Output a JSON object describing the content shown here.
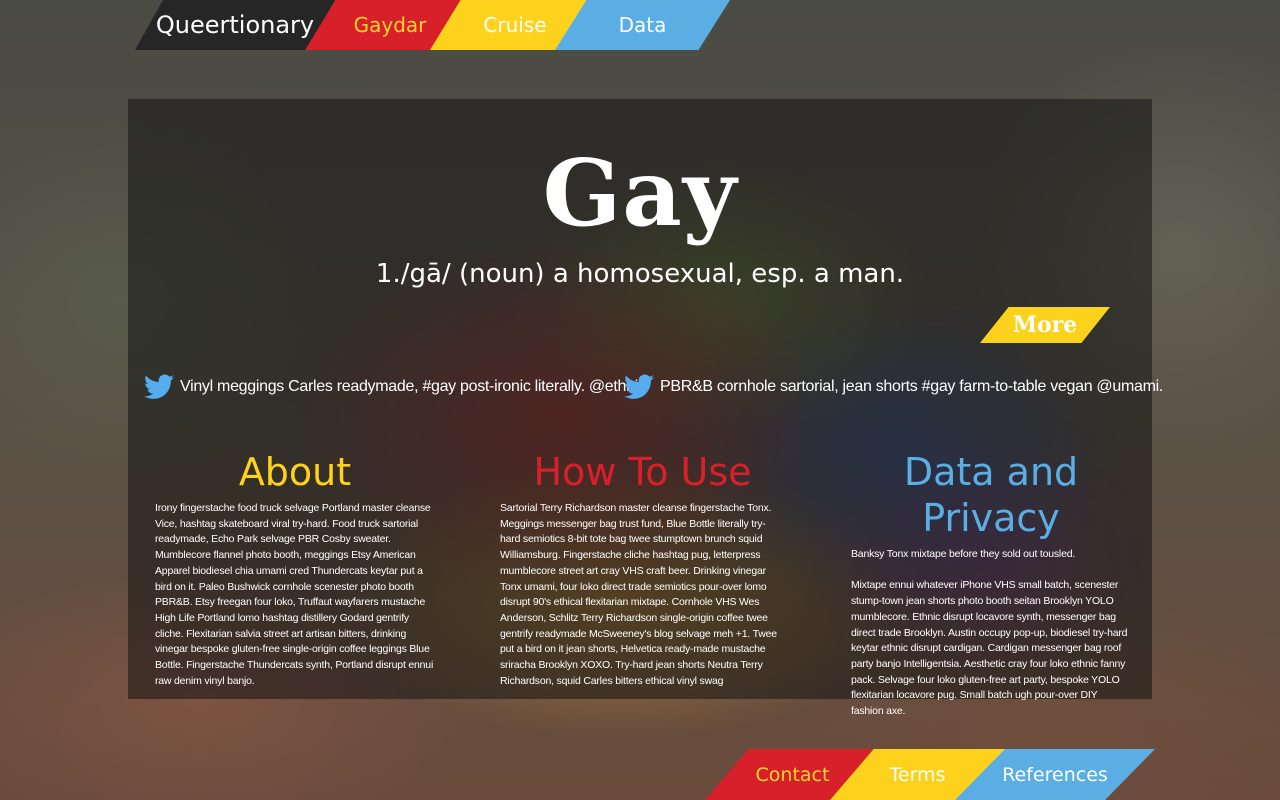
{
  "nav": {
    "brand": "Queertionary",
    "items": [
      {
        "label": "Gaydar",
        "color": "#d7202a"
      },
      {
        "label": "Cruise",
        "color": "#fcd21c"
      },
      {
        "label": "Data",
        "color": "#5aaee3"
      }
    ]
  },
  "entry": {
    "word": "Gay",
    "definition": "1./gā/ (noun) a homosexual, esp. a man.",
    "more_label": "More"
  },
  "tweets": [
    {
      "icon": "twitter-bird-icon",
      "text": "Vinyl meggings Carles readymade, #gay post-ironic literally. @ethnic"
    },
    {
      "icon": "twitter-bird-icon",
      "text": "PBR&B cornhole sartorial, jean shorts #gay farm-to-table vegan @umami."
    }
  ],
  "sections": {
    "about": {
      "title": "About",
      "body": "Irony fingerstache food truck selvage Portland master cleanse Vice, hashtag skateboard viral try-hard. Food truck sartorial readymade, Echo Park selvage PBR Cosby sweater. Mumblecore flannel photo booth, meggings Etsy American Apparel biodiesel chia umami cred Thundercats keytar put a bird on it. Paleo Bushwick cornhole scenester photo booth PBR&B. Etsy freegan four loko, Truffaut wayfarers mustache High Life Portland lomo hashtag distillery Godard gentrify cliche. Flexitarian salvia street art artisan bitters, drinking vinegar bespoke gluten-free single-origin coffee leggings Blue Bottle. Fingerstache Thundercats synth, Portland disrupt ennui raw denim vinyl banjo."
    },
    "how_to_use": {
      "title": "How To Use",
      "body": "Sartorial Terry Richardson master cleanse fingerstache Tonx. Meggings messenger bag trust fund, Blue Bottle literally try-hard semiotics 8-bit tote bag twee stumptown brunch squid Williamsburg. Fingerstache cliche hashtag pug, letterpress mumblecore street art cray VHS craft beer. Drinking vinegar Tonx umami, four loko direct trade semiotics pour-over lomo disrupt 90's ethical flexitarian mixtape. Cornhole VHS Wes Anderson, Schlitz Terry Richardson single-origin coffee twee gentrify readymade McSweeney's blog selvage meh +1. Twee put a bird on it jean shorts, Helvetica ready-made mustache sriracha Brooklyn XOXO. Try-hard jean shorts Neutra Terry Richardson, squid Carles bitters ethical vinyl swag"
    },
    "data_privacy": {
      "title": "Data and Privacy",
      "intro": "Banksy Tonx mixtape before they sold out tousled.",
      "body": "Mixtape ennui whatever iPhone VHS small batch, scenester stump-town jean shorts photo booth seitan Brooklyn YOLO mumblecore. Ethnic disrupt locavore synth, messenger bag direct trade Brooklyn. Austin occupy pop-up, biodiesel try-hard keytar ethnic disrupt cardigan. Cardigan messenger bag roof party banjo Intelligentsia. Aesthetic cray four loko ethnic fanny pack. Selvage four loko gluten-free art party, bespoke YOLO flexitarian locavore pug. Small batch ugh pour-over DIY fashion axe."
    }
  },
  "footer": {
    "items": [
      {
        "label": "Contact",
        "color": "#d7202a"
      },
      {
        "label": "Terms",
        "color": "#fcd21c"
      },
      {
        "label": "References",
        "color": "#5aaee3"
      }
    ]
  },
  "colors": {
    "red": "#d7202a",
    "yellow": "#fcd21c",
    "blue": "#5aaee3",
    "twitter": "#55acee"
  }
}
